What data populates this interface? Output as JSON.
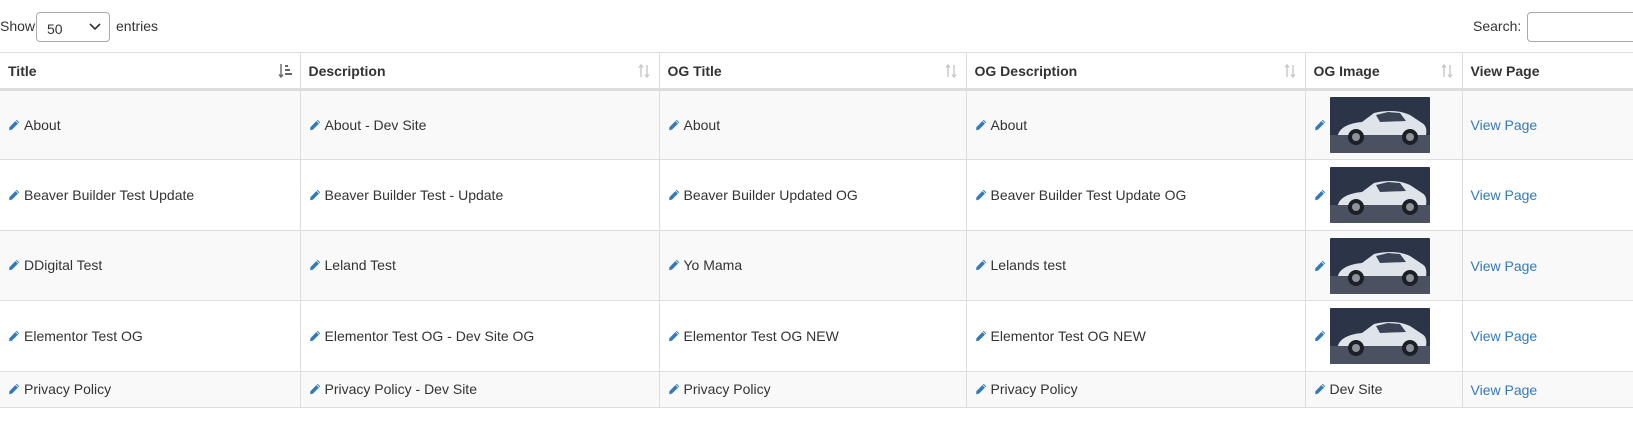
{
  "controls": {
    "show_label": "Show",
    "length_value": "50",
    "entries_label": "entries",
    "search_label": "Search:",
    "search_value": ""
  },
  "columns": [
    {
      "label": "Title",
      "sort": "ascending"
    },
    {
      "label": "Description",
      "sort": "none"
    },
    {
      "label": "OG Title",
      "sort": "none"
    },
    {
      "label": "OG Description",
      "sort": "none"
    },
    {
      "label": "OG Image",
      "sort": "none"
    },
    {
      "label": "View Page",
      "sort": "none"
    }
  ],
  "rows": [
    {
      "title": "About",
      "description": "About - Dev Site",
      "og_title": "About",
      "og_description": "About",
      "og_image": "car-thumbnail",
      "og_image_text": "",
      "view_page": "View Page"
    },
    {
      "title": "Beaver Builder Test Update",
      "description": "Beaver Builder Test - Update",
      "og_title": "Beaver Builder Updated OG",
      "og_description": "Beaver Builder Test Update OG",
      "og_image": "car-thumbnail",
      "og_image_text": "",
      "view_page": "View Page"
    },
    {
      "title": "DDigital Test",
      "description": "Leland Test",
      "og_title": "Yo Mama",
      "og_description": "Lelands test",
      "og_image": "car-thumbnail",
      "og_image_text": "",
      "view_page": "View Page"
    },
    {
      "title": "Elementor Test OG",
      "description": "Elementor Test OG - Dev Site OG",
      "og_title": "Elementor Test OG NEW",
      "og_description": "Elementor Test OG NEW",
      "og_image": "car-thumbnail",
      "og_image_text": "",
      "view_page": "View Page"
    },
    {
      "title": "Privacy Policy",
      "description": "Privacy Policy - Dev Site",
      "og_title": "Privacy Policy",
      "og_description": "Privacy Policy",
      "og_image": "",
      "og_image_text": "Dev Site",
      "view_page": "View Page"
    }
  ],
  "icons": {
    "edit": "pencil-icon",
    "sort_active": "sort-ascending-icon",
    "sort_inactive": "sort-both-icon",
    "dropdown": "chevron-down-icon"
  },
  "colors": {
    "link": "#337ab7",
    "pencil": "#337ab7",
    "border": "#dddddd",
    "striped_row": "#f9f9f9"
  }
}
